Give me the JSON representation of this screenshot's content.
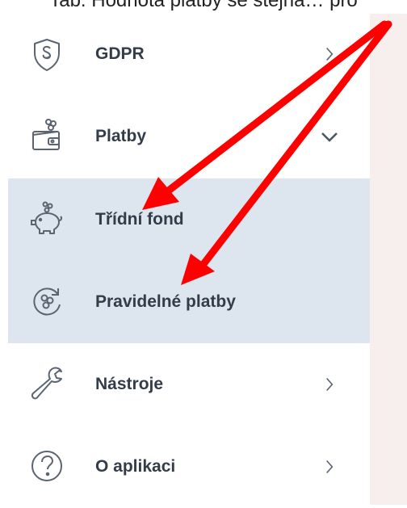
{
  "caption": "Tab. Hodnota platby se stejná… pro",
  "menu": {
    "items": [
      {
        "label": "GDPR",
        "icon": "shield-paragraph-icon"
      },
      {
        "label": "Platby",
        "icon": "wallet-coins-icon",
        "expanded": true
      },
      {
        "label": "Třídní fond",
        "icon": "piggy-bank-icon",
        "submenu": true
      },
      {
        "label": "Pravidelné platby",
        "icon": "recurring-coins-icon",
        "submenu": true
      },
      {
        "label": "Nástroje",
        "icon": "wrench-icon"
      },
      {
        "label": "O aplikaci",
        "icon": "question-circle-icon"
      }
    ]
  },
  "annotation": {
    "arrow_color": "#ff0000"
  },
  "colors": {
    "submenu_bg": "#dde6ee",
    "text": "#333d4a",
    "icon": "#5b6572",
    "side_panel": "#f7eeee"
  }
}
